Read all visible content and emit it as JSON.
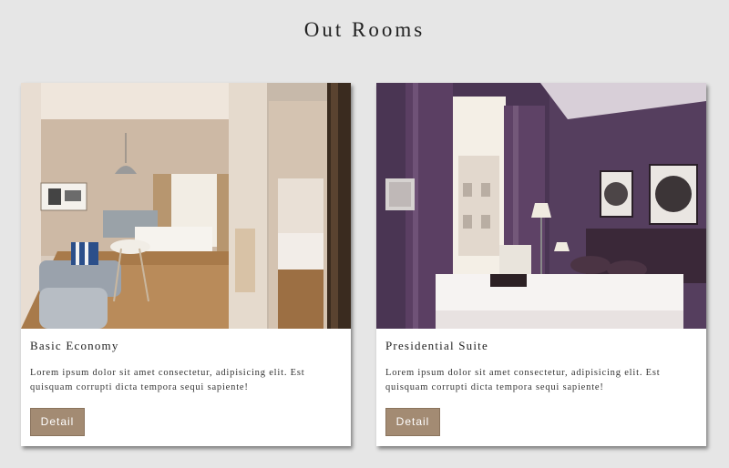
{
  "section": {
    "title": "Out Rooms"
  },
  "rooms": [
    {
      "title": "Basic Economy",
      "text": "Lorem ipsum dolor sit amet consectetur, adipisicing elit. Est quisquam corrupti dicta tempora sequi sapiente!",
      "button_label": "Detail",
      "photo": "hotel-room-photo-economy"
    },
    {
      "title": "Presidential Suite",
      "text": "Lorem ipsum dolor sit amet consectetur, adipisicing elit. Est quisquam corrupti dicta tempora sequi sapiente!",
      "button_label": "Detail",
      "photo": "hotel-room-photo-suite"
    }
  ],
  "colors": {
    "page_background": "#e6e6e6",
    "card_background": "#ffffff",
    "button_background": "#a38b73",
    "button_text": "#ffffff"
  }
}
